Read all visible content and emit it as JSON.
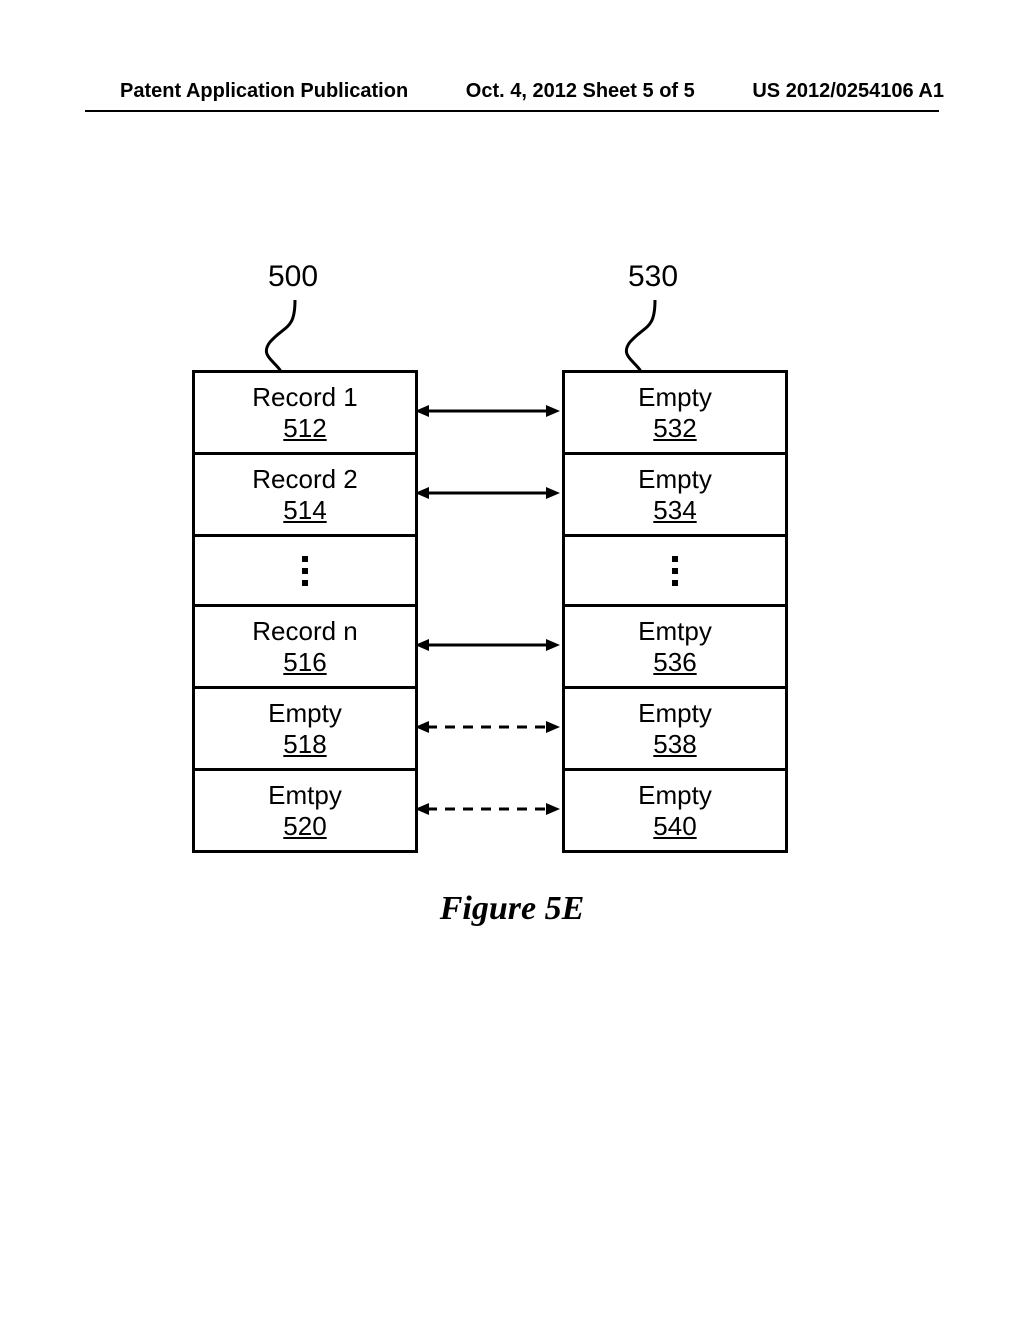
{
  "header": {
    "left": "Patent Application Publication",
    "center": "Oct. 4, 2012   Sheet 5 of 5",
    "right": "US 2012/0254106 A1"
  },
  "caption": "Figure 5E",
  "refs": {
    "left": "500",
    "right": "530"
  },
  "left_table": [
    {
      "label": "Record 1",
      "ref": "512"
    },
    {
      "label": "Record 2",
      "ref": "514"
    },
    {
      "dots": true
    },
    {
      "label": "Record n",
      "ref": "516"
    },
    {
      "label": "Empty",
      "ref": "518"
    },
    {
      "label": "Emtpy",
      "ref": "520"
    }
  ],
  "right_table": [
    {
      "label": "Empty",
      "ref": "532"
    },
    {
      "label": "Empty",
      "ref": "534"
    },
    {
      "dots": true
    },
    {
      "label": "Emtpy",
      "ref": "536"
    },
    {
      "label": "Empty",
      "ref": "538"
    },
    {
      "label": "Empty",
      "ref": "540"
    }
  ],
  "arrows": [
    {
      "type": "solid"
    },
    {
      "type": "solid"
    },
    {
      "type": "none"
    },
    {
      "type": "solid"
    },
    {
      "type": "dashed"
    },
    {
      "type": "dashed"
    }
  ]
}
